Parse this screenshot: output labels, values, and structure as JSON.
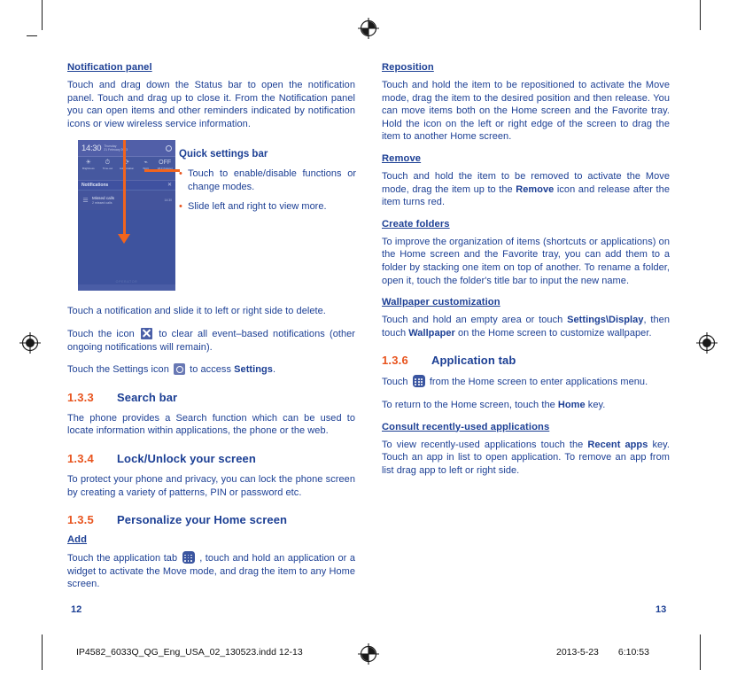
{
  "document": {
    "left_page_number": "12",
    "right_page_number": "13",
    "imprint_file": "IP4582_6033Q_QG_Eng_USA_02_130523.indd   12-13",
    "imprint_date": "2013-5-23",
    "imprint_time": "6:10:53"
  },
  "colors": {
    "heading_blue": "#1c3f94",
    "accent_orange": "#e8541e",
    "body_blue": "#1c3f94",
    "phone_screen": "#3e539e"
  },
  "left_column": {
    "heading_notification_panel": "Notification panel",
    "para_notification_panel": "Touch and drag down the Status bar to open the notification panel. Touch and drag up to close it. From the Notification panel you can open items and other reminders indicated by notification icons or view wireless service information.",
    "figure": {
      "status_time": "14:30",
      "status_date_line1": "Thursday",
      "status_date_line2": "21 February 2013",
      "gear_icon": "gear-icon",
      "quick_settings": [
        {
          "glyph": "☀",
          "label": "Brightness"
        },
        {
          "glyph": "⏱",
          "label": "Time-out"
        },
        {
          "glyph": "⟳",
          "label": "Auto rotation"
        },
        {
          "glyph": "⌁",
          "label": "Wi-Fi"
        },
        {
          "glyph": "OFF",
          "label": "Wi-Fi hotspot"
        }
      ],
      "notifications_title": "Notifications",
      "notifications_close": "✕",
      "notification_item": {
        "icon": "missed-call-icon",
        "title": "Missed calls",
        "subtitle": "2 missed calls",
        "time": "14:30"
      },
      "footer_text": "OPERATOR"
    },
    "callout": {
      "title": "Quick settings bar",
      "bullets": [
        "Touch to enable/disable functions or change modes.",
        "Slide left and right to view more."
      ]
    },
    "para_delete_notification": "Touch a notification and slide it to left or right side to delete.",
    "para_clear_part1": "Touch the icon",
    "para_clear_part2": "to clear all event–based notifications (other ongoing notifications will remain).",
    "para_settings_part1": "Touch the Settings icon",
    "para_settings_part2": "to access",
    "para_settings_bold": "Settings",
    "para_settings_end": ".",
    "section_133_num": "1.3.3",
    "section_133_title": "Search bar",
    "para_search": "The phone provides a Search function which can be used to locate information within applications, the phone or the web.",
    "section_134_num": "1.3.4",
    "section_134_title": "Lock/Unlock your screen",
    "para_lock": "To protect your phone and privacy, you can lock the phone screen by creating a variety of patterns, PIN or password etc.",
    "section_135_num": "1.3.5",
    "section_135_title": "Personalize your Home screen",
    "heading_add": "Add",
    "para_add_part1": "Touch the application tab",
    "para_add_part2": ", touch and hold an application or a widget to activate the Move mode, and drag the item to any Home screen."
  },
  "right_column": {
    "heading_reposition": "Reposition",
    "para_reposition": "Touch and hold the item to be repositioned to activate the Move mode, drag the item to the desired position and then release. You can move items both on the Home screen and the Favorite tray. Hold the icon on the left or right edge of the screen to drag the item to another Home screen.",
    "heading_remove": "Remove",
    "para_remove_part1": "Touch and hold the item to be removed to activate the Move mode, drag the item up to the",
    "para_remove_bold": "Remove",
    "para_remove_part2": "icon and release after the item turns red.",
    "heading_create_folders": "Create folders",
    "para_create_folders": "To improve the organization of items (shortcuts or applications) on the Home screen and the Favorite tray, you can add them to a folder by stacking one item on top of another.  To rename a folder, open it, touch the folder's title bar to input the new name.",
    "heading_wallpaper": "Wallpaper customization",
    "para_wallpaper_part1": "Touch and hold an empty area or touch",
    "para_wallpaper_bold1": "Settings\\Display",
    "para_wallpaper_part2": ", then touch",
    "para_wallpaper_bold2": "Wallpaper",
    "para_wallpaper_part3": "on the Home screen to customize wallpaper.",
    "section_136_num": "1.3.6",
    "section_136_title": "Application tab",
    "para_app_tab_part1": "Touch",
    "para_app_tab_part2": "from the Home screen to enter applications menu.",
    "para_home_part1": "To return to the Home screen, touch the",
    "para_home_bold": "Home",
    "para_home_part2": "key.",
    "heading_consult": "Consult recently-used applications",
    "para_consult_part1": "To view recently-used applications touch the",
    "para_consult_bold": "Recent apps",
    "para_consult_part2": "key. Touch an app in list to open application. To remove an app from list drag app to left or right side."
  }
}
